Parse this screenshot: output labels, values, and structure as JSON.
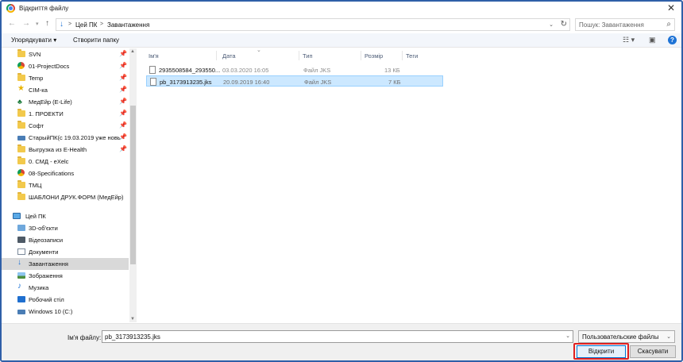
{
  "window": {
    "title": "Відкриття файлу",
    "close_glyph": "✕"
  },
  "address": {
    "crumbs": [
      "Цей ПК",
      "Завантаження"
    ],
    "separator": ">",
    "search_placeholder": "Пошук: Завантаження"
  },
  "toolbar": {
    "organize_label": "Упорядкувати ▾",
    "new_folder_label": "Створити папку"
  },
  "columns": {
    "name": "Ім'я",
    "date": "Дата",
    "type": "Тип",
    "size": "Розмір",
    "tags": "Теги"
  },
  "files": [
    {
      "name": "2935508584_293550...",
      "date": "03.03.2020 16:05",
      "type": "Файл JKS",
      "size": "13 КБ",
      "selected": false
    },
    {
      "name": "pb_3173913235.jks",
      "date": "20.09.2019 16:40",
      "type": "Файл JKS",
      "size": "7 КБ",
      "selected": true
    }
  ],
  "nav": {
    "quick_access": [
      {
        "label": "SVN",
        "icon": "folder-icon",
        "pinned": true
      },
      {
        "label": "01-ProjectDocs",
        "icon": "chrome-icon",
        "pinned": true
      },
      {
        "label": "Temp",
        "icon": "folder-icon",
        "pinned": true
      },
      {
        "label": "СІМ-ка",
        "icon": "star-icon",
        "pinned": true
      },
      {
        "label": "МедЕйр (E-Life)",
        "icon": "tree-icon",
        "pinned": true
      },
      {
        "label": "1. ПРОЕКТИ",
        "icon": "folder-icon",
        "pinned": true
      },
      {
        "label": "Софт",
        "icon": "folder-icon",
        "pinned": true
      },
      {
        "label": "СтарыйПК(с 19.03.2019 уже новь",
        "icon": "hdd-icon",
        "pinned": true
      },
      {
        "label": "Выгрузка из E-Health",
        "icon": "folder-icon",
        "pinned": true
      },
      {
        "label": "0. СМД - eXelc",
        "icon": "folder-icon",
        "pinned": false
      },
      {
        "label": "08-Specifications",
        "icon": "chrome-icon",
        "pinned": false
      },
      {
        "label": "ТМЦ",
        "icon": "folder-icon",
        "pinned": false
      },
      {
        "label": "ШАБЛОНИ ДРУК.ФОРМ (МедЕйр)",
        "icon": "folder-icon",
        "pinned": false
      }
    ],
    "this_pc": {
      "label": "Цей ПК",
      "icon": "monitor-icon"
    },
    "pc_items": [
      {
        "label": "3D-об'єкти",
        "icon": "cube-icon"
      },
      {
        "label": "Відеозаписи",
        "icon": "video-icon"
      },
      {
        "label": "Документи",
        "icon": "document-icon"
      },
      {
        "label": "Завантаження",
        "icon": "download-icon",
        "selected": true
      },
      {
        "label": "Зображення",
        "icon": "image-icon"
      },
      {
        "label": "Музика",
        "icon": "music-icon"
      },
      {
        "label": "Робочий стіл",
        "icon": "desktop-icon"
      },
      {
        "label": "Windows 10 (C:)",
        "icon": "drive-icon"
      }
    ]
  },
  "bottom": {
    "filename_label": "Ім'я файлу:",
    "filename_value": "pb_3173913235.jks",
    "filetype_value": "Пользовательские файлы",
    "open_label": "Відкрити",
    "cancel_label": "Скасувати"
  },
  "colors": {
    "accent": "#0078d7",
    "selection": "#cce8ff",
    "highlight_box": "#e02020",
    "window_border": "#2f5fa8"
  }
}
